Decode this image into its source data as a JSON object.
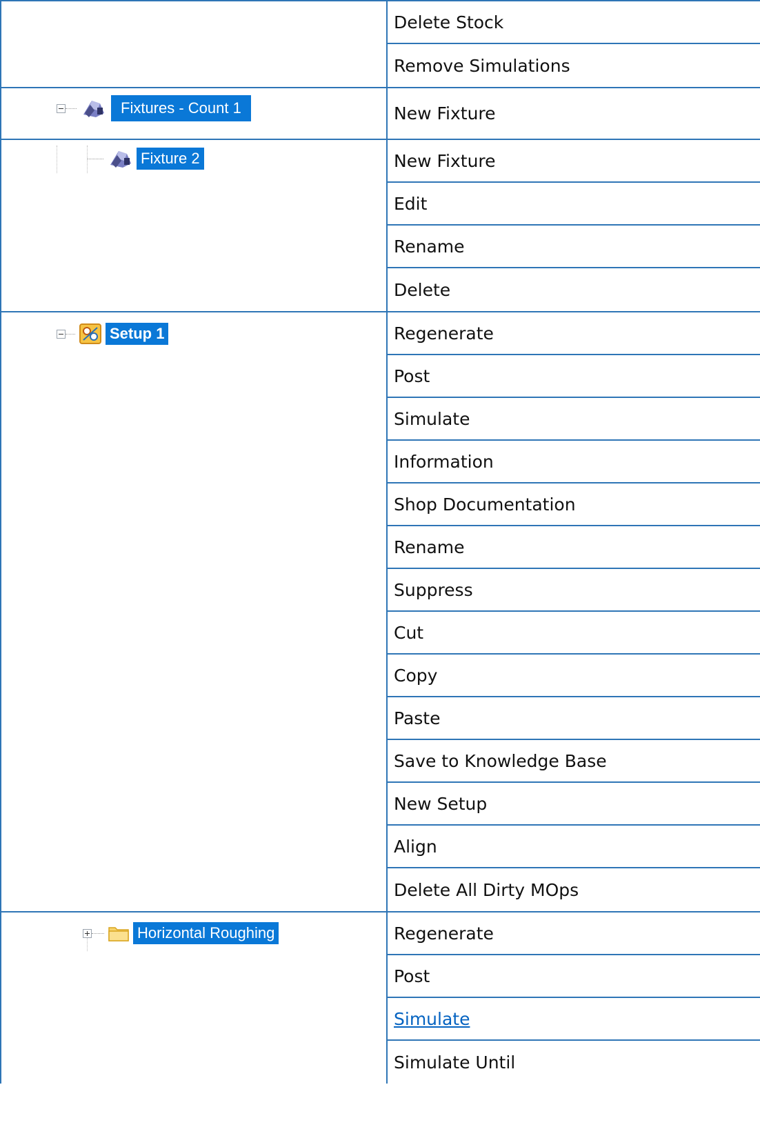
{
  "groups": [
    {
      "tree": null,
      "commands": [
        {
          "label": "Delete Stock"
        },
        {
          "label": "Remove Simulations"
        }
      ]
    },
    {
      "tree": {
        "label": "Fixtures - Count 1",
        "icon": "fixture-icon",
        "toggle": "minus"
      },
      "commands": [
        {
          "label": "New Fixture"
        }
      ]
    },
    {
      "tree": {
        "label": "Fixture 2",
        "icon": "fixture-icon",
        "toggle": "none"
      },
      "commands": [
        {
          "label": "New Fixture"
        },
        {
          "label": "Edit"
        },
        {
          "label": "Rename"
        },
        {
          "label": "Delete"
        }
      ]
    },
    {
      "tree": {
        "label": "Setup 1",
        "icon": "setup-icon",
        "toggle": "minus"
      },
      "commands": [
        {
          "label": "Regenerate"
        },
        {
          "label": "Post"
        },
        {
          "label": "Simulate"
        },
        {
          "label": "Information"
        },
        {
          "label": "Shop Documentation"
        },
        {
          "label": "Rename"
        },
        {
          "label": "Suppress"
        },
        {
          "label": "Cut"
        },
        {
          "label": "Copy"
        },
        {
          "label": "Paste"
        },
        {
          "label": "Save to Knowledge Base"
        },
        {
          "label": "New Setup"
        },
        {
          "label": "Align"
        },
        {
          "label": "Delete All Dirty MOps"
        }
      ]
    },
    {
      "tree": {
        "label": "Horizontal Roughing",
        "icon": "folder-icon",
        "toggle": "plus"
      },
      "commands": [
        {
          "label": "Regenerate"
        },
        {
          "label": "Post"
        },
        {
          "label": "Simulate",
          "link": true
        },
        {
          "label": "Simulate Until"
        }
      ]
    }
  ],
  "colors": {
    "border": "#2e75b6",
    "selection": "#0a78d7",
    "link": "#0563c1"
  }
}
